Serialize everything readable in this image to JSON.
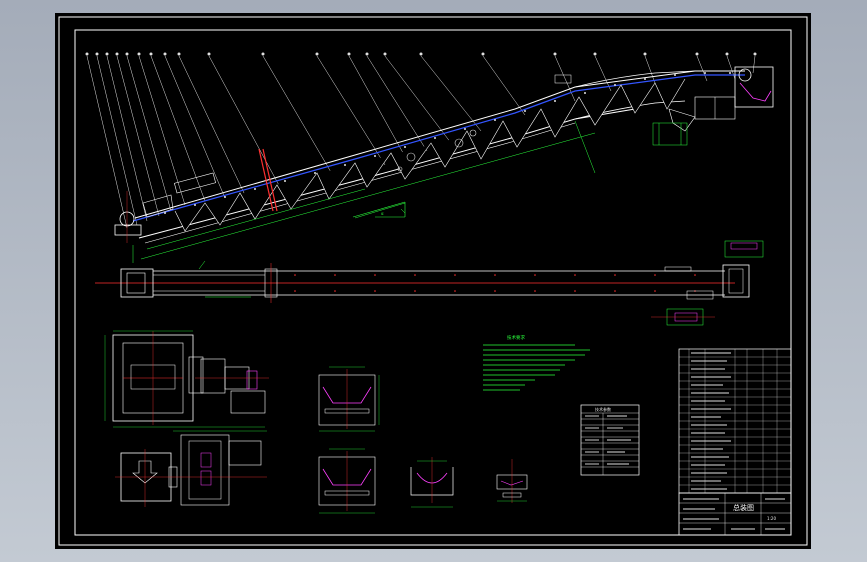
{
  "drawing": {
    "background": "#000000",
    "frame_color": "#ffffff",
    "colors": {
      "outline": "#ffffff",
      "belt": "#3355ff",
      "centerline": "#ff3030",
      "dimension": "#2aff3c",
      "detail": "#00ffff",
      "accent": "#ff40ff",
      "hatching": "#ffff40"
    }
  },
  "views": {
    "elevation": {
      "label": "elevation-view"
    },
    "plan": {
      "label": "plan-view"
    },
    "drive_unit": {
      "label": "drive-unit-detail"
    },
    "idler_troughing": {
      "label": "troughing-idler-detail"
    },
    "idler_return": {
      "label": "return-idler-detail"
    },
    "chute": {
      "label": "chute-detail"
    },
    "clamp": {
      "label": "clamp-detail"
    }
  },
  "notes_block": {
    "heading": "技术要求"
  },
  "parameter_table": {
    "heading": "技术参数"
  },
  "title_block": {
    "drawing_title": "总装图",
    "scale": "1:20"
  }
}
